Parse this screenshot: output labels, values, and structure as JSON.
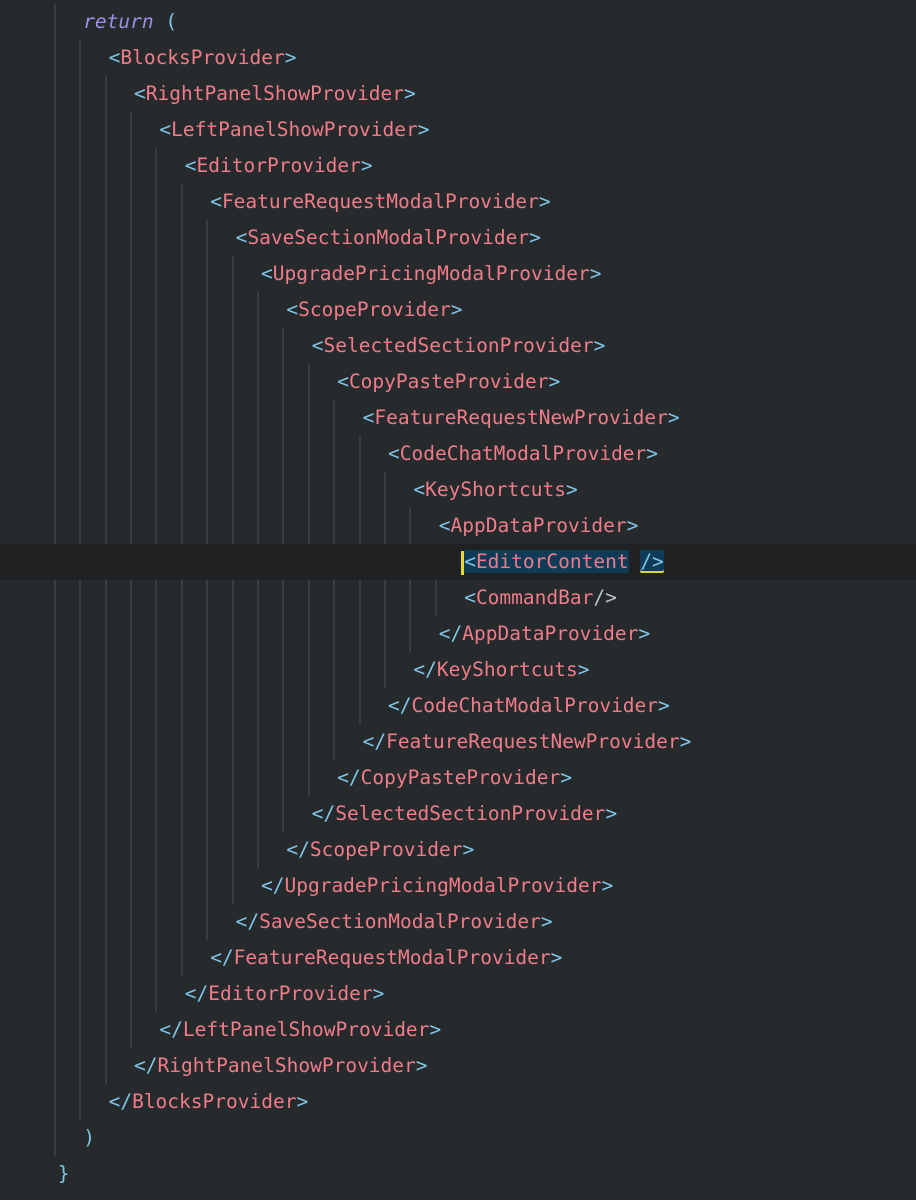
{
  "editor": {
    "lines": [
      {
        "ind": 3,
        "tokens": [
          {
            "t": "return",
            "c": "kw"
          },
          {
            "t": " (",
            "c": "punct"
          }
        ]
      },
      {
        "ind": 4,
        "tokens": [
          {
            "t": "<",
            "c": "punct"
          },
          {
            "t": "BlocksProvider",
            "c": "tag"
          },
          {
            "t": ">",
            "c": "punct"
          }
        ]
      },
      {
        "ind": 5,
        "tokens": [
          {
            "t": "<",
            "c": "punct"
          },
          {
            "t": "RightPanelShowProvider",
            "c": "tag"
          },
          {
            "t": ">",
            "c": "punct"
          }
        ]
      },
      {
        "ind": 6,
        "tokens": [
          {
            "t": "<",
            "c": "punct"
          },
          {
            "t": "LeftPanelShowProvider",
            "c": "tag"
          },
          {
            "t": ">",
            "c": "punct"
          }
        ]
      },
      {
        "ind": 7,
        "tokens": [
          {
            "t": "<",
            "c": "punct"
          },
          {
            "t": "EditorProvider",
            "c": "tag"
          },
          {
            "t": ">",
            "c": "punct"
          }
        ]
      },
      {
        "ind": 8,
        "tokens": [
          {
            "t": "<",
            "c": "punct"
          },
          {
            "t": "FeatureRequestModalProvider",
            "c": "tag"
          },
          {
            "t": ">",
            "c": "punct"
          }
        ]
      },
      {
        "ind": 9,
        "tokens": [
          {
            "t": "<",
            "c": "punct"
          },
          {
            "t": "SaveSectionModalProvider",
            "c": "tag"
          },
          {
            "t": ">",
            "c": "punct"
          }
        ]
      },
      {
        "ind": 10,
        "tokens": [
          {
            "t": "<",
            "c": "punct"
          },
          {
            "t": "UpgradePricingModalProvider",
            "c": "tag"
          },
          {
            "t": ">",
            "c": "punct"
          }
        ]
      },
      {
        "ind": 11,
        "tokens": [
          {
            "t": "<",
            "c": "punct"
          },
          {
            "t": "ScopeProvider",
            "c": "tag"
          },
          {
            "t": ">",
            "c": "punct"
          }
        ]
      },
      {
        "ind": 12,
        "tokens": [
          {
            "t": "<",
            "c": "punct"
          },
          {
            "t": "SelectedSectionProvider",
            "c": "tag"
          },
          {
            "t": ">",
            "c": "punct"
          }
        ]
      },
      {
        "ind": 13,
        "tokens": [
          {
            "t": "<",
            "c": "punct"
          },
          {
            "t": "CopyPasteProvider",
            "c": "tag"
          },
          {
            "t": ">",
            "c": "punct"
          }
        ]
      },
      {
        "ind": 14,
        "tokens": [
          {
            "t": "<",
            "c": "punct"
          },
          {
            "t": "FeatureRequestNewProvider",
            "c": "tag"
          },
          {
            "t": ">",
            "c": "punct"
          }
        ]
      },
      {
        "ind": 15,
        "tokens": [
          {
            "t": "<",
            "c": "punct"
          },
          {
            "t": "CodeChatModalProvider",
            "c": "tag"
          },
          {
            "t": ">",
            "c": "punct"
          }
        ]
      },
      {
        "ind": 16,
        "tokens": [
          {
            "t": "<",
            "c": "punct"
          },
          {
            "t": "KeyShortcuts",
            "c": "tag"
          },
          {
            "t": ">",
            "c": "punct"
          }
        ]
      },
      {
        "ind": 17,
        "tokens": [
          {
            "t": "<",
            "c": "punct"
          },
          {
            "t": "AppDataProvider",
            "c": "tag"
          },
          {
            "t": ">",
            "c": "punct"
          }
        ]
      },
      {
        "ind": 18,
        "current": true,
        "tokens": [
          {
            "t": "<",
            "c": "punct",
            "hl": true,
            "caret": true
          },
          {
            "t": "EditorContent",
            "c": "tag",
            "hl": true
          },
          {
            "t": " ",
            "c": "white"
          },
          {
            "t": "/>",
            "c": "punct",
            "match": true
          }
        ]
      },
      {
        "ind": 18,
        "tokens": [
          {
            "t": "<",
            "c": "punct"
          },
          {
            "t": "CommandBar",
            "c": "tag"
          },
          {
            "t": "/>",
            "c": "white"
          }
        ]
      },
      {
        "ind": 17,
        "tokens": [
          {
            "t": "</",
            "c": "punct"
          },
          {
            "t": "AppDataProvider",
            "c": "tag"
          },
          {
            "t": ">",
            "c": "punct"
          }
        ]
      },
      {
        "ind": 16,
        "tokens": [
          {
            "t": "</",
            "c": "punct"
          },
          {
            "t": "KeyShortcuts",
            "c": "tag"
          },
          {
            "t": ">",
            "c": "punct"
          }
        ]
      },
      {
        "ind": 15,
        "tokens": [
          {
            "t": "</",
            "c": "punct"
          },
          {
            "t": "CodeChatModalProvider",
            "c": "tag"
          },
          {
            "t": ">",
            "c": "punct"
          }
        ]
      },
      {
        "ind": 14,
        "tokens": [
          {
            "t": "</",
            "c": "punct"
          },
          {
            "t": "FeatureRequestNewProvider",
            "c": "tag"
          },
          {
            "t": ">",
            "c": "punct"
          }
        ]
      },
      {
        "ind": 13,
        "tokens": [
          {
            "t": "</",
            "c": "punct"
          },
          {
            "t": "CopyPasteProvider",
            "c": "tag"
          },
          {
            "t": ">",
            "c": "punct"
          }
        ]
      },
      {
        "ind": 12,
        "tokens": [
          {
            "t": "</",
            "c": "punct"
          },
          {
            "t": "SelectedSectionProvider",
            "c": "tag"
          },
          {
            "t": ">",
            "c": "punct"
          }
        ]
      },
      {
        "ind": 11,
        "tokens": [
          {
            "t": "</",
            "c": "punct"
          },
          {
            "t": "ScopeProvider",
            "c": "tag"
          },
          {
            "t": ">",
            "c": "punct"
          }
        ]
      },
      {
        "ind": 10,
        "tokens": [
          {
            "t": "</",
            "c": "punct"
          },
          {
            "t": "UpgradePricingModalProvider",
            "c": "tag"
          },
          {
            "t": ">",
            "c": "punct"
          }
        ]
      },
      {
        "ind": 9,
        "tokens": [
          {
            "t": "</",
            "c": "punct"
          },
          {
            "t": "SaveSectionModalProvider",
            "c": "tag"
          },
          {
            "t": ">",
            "c": "punct"
          }
        ]
      },
      {
        "ind": 8,
        "tokens": [
          {
            "t": "</",
            "c": "punct"
          },
          {
            "t": "FeatureRequestModalProvider",
            "c": "tag"
          },
          {
            "t": ">",
            "c": "punct"
          }
        ]
      },
      {
        "ind": 7,
        "tokens": [
          {
            "t": "</",
            "c": "punct"
          },
          {
            "t": "EditorProvider",
            "c": "tag"
          },
          {
            "t": ">",
            "c": "punct"
          }
        ]
      },
      {
        "ind": 6,
        "tokens": [
          {
            "t": "</",
            "c": "punct"
          },
          {
            "t": "LeftPanelShowProvider",
            "c": "tag"
          },
          {
            "t": ">",
            "c": "punct"
          }
        ]
      },
      {
        "ind": 5,
        "tokens": [
          {
            "t": "</",
            "c": "punct"
          },
          {
            "t": "RightPanelShowProvider",
            "c": "tag"
          },
          {
            "t": ">",
            "c": "punct"
          }
        ]
      },
      {
        "ind": 4,
        "tokens": [
          {
            "t": "</",
            "c": "punct"
          },
          {
            "t": "BlocksProvider",
            "c": "tag"
          },
          {
            "t": ">",
            "c": "punct"
          }
        ]
      },
      {
        "ind": 3,
        "tokens": [
          {
            "t": ")",
            "c": "punct"
          }
        ]
      },
      {
        "ind": 2,
        "tokens": [
          {
            "t": "}",
            "c": "punct"
          }
        ]
      }
    ]
  },
  "theme": {
    "background": "#272a2c",
    "current_line": "#1f2122",
    "punctuation": "#7ec6e8",
    "tag": "#f07b89",
    "keyword": "#9d8ee6",
    "highlight": "#0f3b56",
    "caret": "#e6d93a"
  }
}
